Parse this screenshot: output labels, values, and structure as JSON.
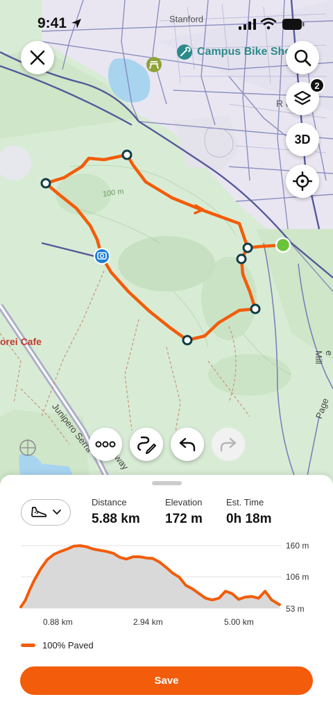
{
  "status_bar": {
    "time": "9:41"
  },
  "map": {
    "labels": {
      "stanford": "Stanford",
      "poi_name": "Campus Bike Sho",
      "partial_house": "R     ouse",
      "contour": "100 m",
      "cafe": "orei Cafe",
      "road_junipero": "Junipero Serra",
      "road_way": "way",
      "road_page": "Page",
      "road_page_mill": "e Mill"
    },
    "buttons": {
      "three_d": "3D",
      "layers_badge": "2"
    },
    "route_color": "#f25c0a"
  },
  "sheet": {
    "sport_icon": "shoe-icon",
    "stats": {
      "distance": {
        "label": "Distance",
        "value": "5.88 km"
      },
      "elevation": {
        "label": "Elevation",
        "value": "172 m"
      },
      "time": {
        "label": "Est. Time",
        "value": "0h 18m"
      }
    },
    "legend": "100% Paved",
    "save_label": "Save"
  },
  "chart_data": {
    "type": "area",
    "title": "",
    "xlabel": "",
    "ylabel": "",
    "x_ticks": [
      "0.88 km",
      "2.94 km",
      "5.00 km"
    ],
    "y_ticks": [
      "160 m",
      "106 m",
      "53 m"
    ],
    "ylim": [
      53,
      160
    ],
    "xlim": [
      0,
      5.88
    ],
    "x": [
      0.0,
      0.1,
      0.2,
      0.3,
      0.45,
      0.6,
      0.75,
      0.9,
      1.05,
      1.2,
      1.35,
      1.5,
      1.65,
      1.8,
      1.95,
      2.1,
      2.25,
      2.4,
      2.55,
      2.7,
      2.85,
      3.0,
      3.15,
      3.3,
      3.45,
      3.6,
      3.75,
      3.9,
      4.05,
      4.2,
      4.35,
      4.5,
      4.65,
      4.8,
      4.95,
      5.1,
      5.25,
      5.4,
      5.55,
      5.7,
      5.88
    ],
    "values": [
      55,
      66,
      84,
      100,
      120,
      136,
      145,
      150,
      154,
      159,
      160,
      158,
      154,
      152,
      150,
      147,
      140,
      137,
      141,
      141,
      139,
      138,
      132,
      123,
      113,
      106,
      92,
      86,
      78,
      70,
      67,
      70,
      82,
      78,
      68,
      72,
      73,
      70,
      82,
      67,
      59
    ],
    "series": [
      {
        "name": "100% Paved",
        "color": "#f25c0a"
      }
    ],
    "fill_color": "#d9d9d9",
    "grid": true
  }
}
